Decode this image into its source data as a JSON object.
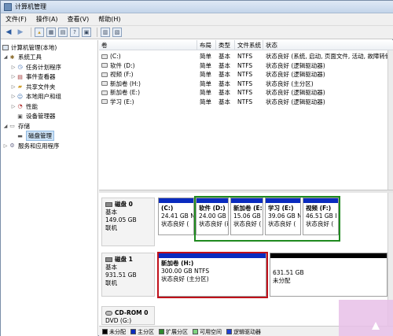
{
  "window": {
    "title": "计算机管理"
  },
  "menu": [
    "文件(F)",
    "操作(A)",
    "查看(V)",
    "帮助(H)"
  ],
  "toolbar": {
    "icons": [
      "back-arrow-icon",
      "forward-arrow-icon",
      "up-folder-icon",
      "show-tree-icon",
      "properties-icon",
      "help-icon",
      "new-window-icon",
      "export-icon"
    ]
  },
  "tree": {
    "root": "计算机管理(本地)",
    "items": [
      {
        "label": "系统工具",
        "level": 1
      },
      {
        "label": "任务计划程序",
        "level": 2
      },
      {
        "label": "事件查看器",
        "level": 2
      },
      {
        "label": "共享文件夹",
        "level": 2
      },
      {
        "label": "本地用户和组",
        "level": 2
      },
      {
        "label": "性能",
        "level": 2
      },
      {
        "label": "设备管理器",
        "level": 2
      },
      {
        "label": "存储",
        "level": 1
      },
      {
        "label": "磁盘管理",
        "level": 2
      },
      {
        "label": "服务和应用程序",
        "level": 1
      }
    ]
  },
  "volumes": {
    "headers": [
      "卷",
      "布局",
      "类型",
      "文件系统",
      "状态"
    ],
    "rows": [
      [
        "(C:)",
        "简单",
        "基本",
        "NTFS",
        "状态良好 (系统, 启动, 页面文件, 活动, 故障转储"
      ],
      [
        "软件 (D:)",
        "简单",
        "基本",
        "NTFS",
        "状态良好 (逻辑驱动器)"
      ],
      [
        "视频 (F:)",
        "简单",
        "基本",
        "NTFS",
        "状态良好 (逻辑驱动器)"
      ],
      [
        "新加卷 (H:)",
        "简单",
        "基本",
        "NTFS",
        "状态良好 (主分区)"
      ],
      [
        "新加卷 (E:)",
        "简单",
        "基本",
        "NTFS",
        "状态良好 (逻辑驱动器)"
      ],
      [
        "学习 (E:)",
        "简单",
        "基本",
        "NTFS",
        "状态良好 (逻辑驱动器)"
      ]
    ]
  },
  "disk0": {
    "name": "磁盘 0",
    "type": "基本",
    "size": "149.05 GB",
    "status": "联机",
    "partitions": [
      {
        "name": "(C:)",
        "size": "24.41 GB N",
        "status": "状态良好 ("
      },
      {
        "name": "软件 (D:)",
        "size": "24.00 GB",
        "status": "状态良好 (i"
      },
      {
        "name": "新加卷 (E:)",
        "size": "15.06 GB",
        "status": "状态良好 ("
      },
      {
        "name": "学习 (E:)",
        "size": "39.06 GB N",
        "status": "状态良好 ("
      },
      {
        "name": "视频 (F:)",
        "size": "46.51 GB I",
        "status": "状态良好 ("
      }
    ]
  },
  "disk1": {
    "name": "磁盘 1",
    "type": "基本",
    "size": "931.51 GB",
    "status": "联机",
    "partitions": [
      {
        "name": "新加卷 (H:)",
        "size": "300.00 GB NTFS",
        "status": "状态良好 (主分区)"
      },
      {
        "name": "",
        "size": "631.51 GB",
        "status": "未分配"
      }
    ]
  },
  "cdrom": {
    "name": "CD-ROM 0",
    "drive": "DVD (G:)"
  },
  "legend": [
    {
      "label": "未分配",
      "color": "#000000"
    },
    {
      "label": "主分区",
      "color": "#0a2bbf"
    },
    {
      "label": "扩展分区",
      "color": "#2e8b2e"
    },
    {
      "label": "可用空间",
      "color": "#7fd37f"
    },
    {
      "label": "逻辑驱动器",
      "color": "#1e3fd6"
    }
  ],
  "highlight": {
    "green": "#1f8a1f",
    "red": "#c0101a"
  }
}
